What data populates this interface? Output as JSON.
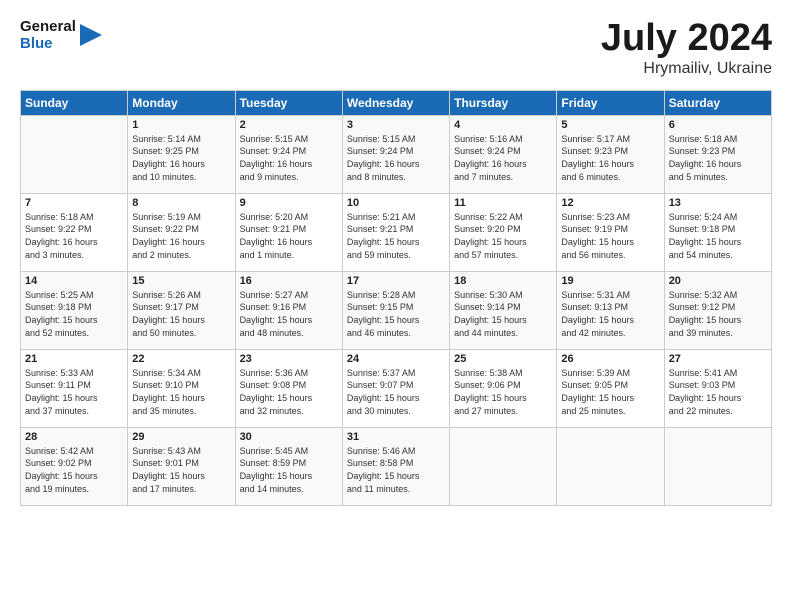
{
  "header": {
    "logo_line1": "General",
    "logo_line2": "Blue",
    "month_year": "July 2024",
    "location": "Hrymailiv, Ukraine"
  },
  "weekdays": [
    "Sunday",
    "Monday",
    "Tuesday",
    "Wednesday",
    "Thursday",
    "Friday",
    "Saturday"
  ],
  "weeks": [
    [
      {
        "day": "",
        "info": ""
      },
      {
        "day": "1",
        "info": "Sunrise: 5:14 AM\nSunset: 9:25 PM\nDaylight: 16 hours\nand 10 minutes."
      },
      {
        "day": "2",
        "info": "Sunrise: 5:15 AM\nSunset: 9:24 PM\nDaylight: 16 hours\nand 9 minutes."
      },
      {
        "day": "3",
        "info": "Sunrise: 5:15 AM\nSunset: 9:24 PM\nDaylight: 16 hours\nand 8 minutes."
      },
      {
        "day": "4",
        "info": "Sunrise: 5:16 AM\nSunset: 9:24 PM\nDaylight: 16 hours\nand 7 minutes."
      },
      {
        "day": "5",
        "info": "Sunrise: 5:17 AM\nSunset: 9:23 PM\nDaylight: 16 hours\nand 6 minutes."
      },
      {
        "day": "6",
        "info": "Sunrise: 5:18 AM\nSunset: 9:23 PM\nDaylight: 16 hours\nand 5 minutes."
      }
    ],
    [
      {
        "day": "7",
        "info": "Sunrise: 5:18 AM\nSunset: 9:22 PM\nDaylight: 16 hours\nand 3 minutes."
      },
      {
        "day": "8",
        "info": "Sunrise: 5:19 AM\nSunset: 9:22 PM\nDaylight: 16 hours\nand 2 minutes."
      },
      {
        "day": "9",
        "info": "Sunrise: 5:20 AM\nSunset: 9:21 PM\nDaylight: 16 hours\nand 1 minute."
      },
      {
        "day": "10",
        "info": "Sunrise: 5:21 AM\nSunset: 9:21 PM\nDaylight: 15 hours\nand 59 minutes."
      },
      {
        "day": "11",
        "info": "Sunrise: 5:22 AM\nSunset: 9:20 PM\nDaylight: 15 hours\nand 57 minutes."
      },
      {
        "day": "12",
        "info": "Sunrise: 5:23 AM\nSunset: 9:19 PM\nDaylight: 15 hours\nand 56 minutes."
      },
      {
        "day": "13",
        "info": "Sunrise: 5:24 AM\nSunset: 9:18 PM\nDaylight: 15 hours\nand 54 minutes."
      }
    ],
    [
      {
        "day": "14",
        "info": "Sunrise: 5:25 AM\nSunset: 9:18 PM\nDaylight: 15 hours\nand 52 minutes."
      },
      {
        "day": "15",
        "info": "Sunrise: 5:26 AM\nSunset: 9:17 PM\nDaylight: 15 hours\nand 50 minutes."
      },
      {
        "day": "16",
        "info": "Sunrise: 5:27 AM\nSunset: 9:16 PM\nDaylight: 15 hours\nand 48 minutes."
      },
      {
        "day": "17",
        "info": "Sunrise: 5:28 AM\nSunset: 9:15 PM\nDaylight: 15 hours\nand 46 minutes."
      },
      {
        "day": "18",
        "info": "Sunrise: 5:30 AM\nSunset: 9:14 PM\nDaylight: 15 hours\nand 44 minutes."
      },
      {
        "day": "19",
        "info": "Sunrise: 5:31 AM\nSunset: 9:13 PM\nDaylight: 15 hours\nand 42 minutes."
      },
      {
        "day": "20",
        "info": "Sunrise: 5:32 AM\nSunset: 9:12 PM\nDaylight: 15 hours\nand 39 minutes."
      }
    ],
    [
      {
        "day": "21",
        "info": "Sunrise: 5:33 AM\nSunset: 9:11 PM\nDaylight: 15 hours\nand 37 minutes."
      },
      {
        "day": "22",
        "info": "Sunrise: 5:34 AM\nSunset: 9:10 PM\nDaylight: 15 hours\nand 35 minutes."
      },
      {
        "day": "23",
        "info": "Sunrise: 5:36 AM\nSunset: 9:08 PM\nDaylight: 15 hours\nand 32 minutes."
      },
      {
        "day": "24",
        "info": "Sunrise: 5:37 AM\nSunset: 9:07 PM\nDaylight: 15 hours\nand 30 minutes."
      },
      {
        "day": "25",
        "info": "Sunrise: 5:38 AM\nSunset: 9:06 PM\nDaylight: 15 hours\nand 27 minutes."
      },
      {
        "day": "26",
        "info": "Sunrise: 5:39 AM\nSunset: 9:05 PM\nDaylight: 15 hours\nand 25 minutes."
      },
      {
        "day": "27",
        "info": "Sunrise: 5:41 AM\nSunset: 9:03 PM\nDaylight: 15 hours\nand 22 minutes."
      }
    ],
    [
      {
        "day": "28",
        "info": "Sunrise: 5:42 AM\nSunset: 9:02 PM\nDaylight: 15 hours\nand 19 minutes."
      },
      {
        "day": "29",
        "info": "Sunrise: 5:43 AM\nSunset: 9:01 PM\nDaylight: 15 hours\nand 17 minutes."
      },
      {
        "day": "30",
        "info": "Sunrise: 5:45 AM\nSunset: 8:59 PM\nDaylight: 15 hours\nand 14 minutes."
      },
      {
        "day": "31",
        "info": "Sunrise: 5:46 AM\nSunset: 8:58 PM\nDaylight: 15 hours\nand 11 minutes."
      },
      {
        "day": "",
        "info": ""
      },
      {
        "day": "",
        "info": ""
      },
      {
        "day": "",
        "info": ""
      }
    ]
  ]
}
